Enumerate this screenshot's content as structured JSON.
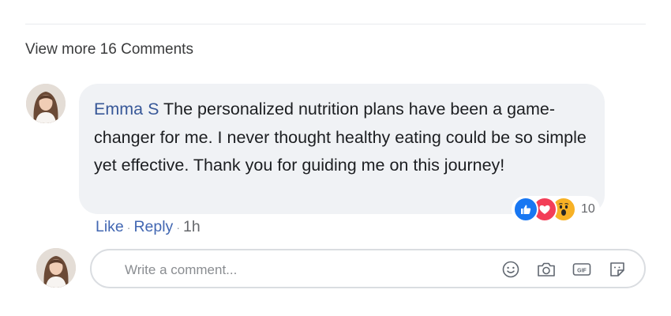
{
  "comments_section": {
    "view_more_label": "View more 16 Comments"
  },
  "comment": {
    "author": "Emma S",
    "text": "The personalized nutrition plans have been a game-changer for me. I never thought healthy eating could be so simple yet effective. Thank you for guiding me on this journey!",
    "reactions": {
      "types": [
        "like-icon",
        "love-icon",
        "wow-icon"
      ],
      "count": "10"
    },
    "actions": {
      "like_label": "Like",
      "reply_label": "Reply",
      "separator": "·",
      "timestamp": "1h"
    }
  },
  "composer": {
    "placeholder": "Write a comment...",
    "tools": [
      "emoji-icon",
      "camera-icon",
      "gif-icon",
      "sticker-icon"
    ]
  },
  "colors": {
    "link": "#4267b2",
    "author": "#385898",
    "bubble": "#f0f2f5",
    "like": "#1877f2",
    "love": "#f33e58",
    "wow": "#f7b125"
  }
}
